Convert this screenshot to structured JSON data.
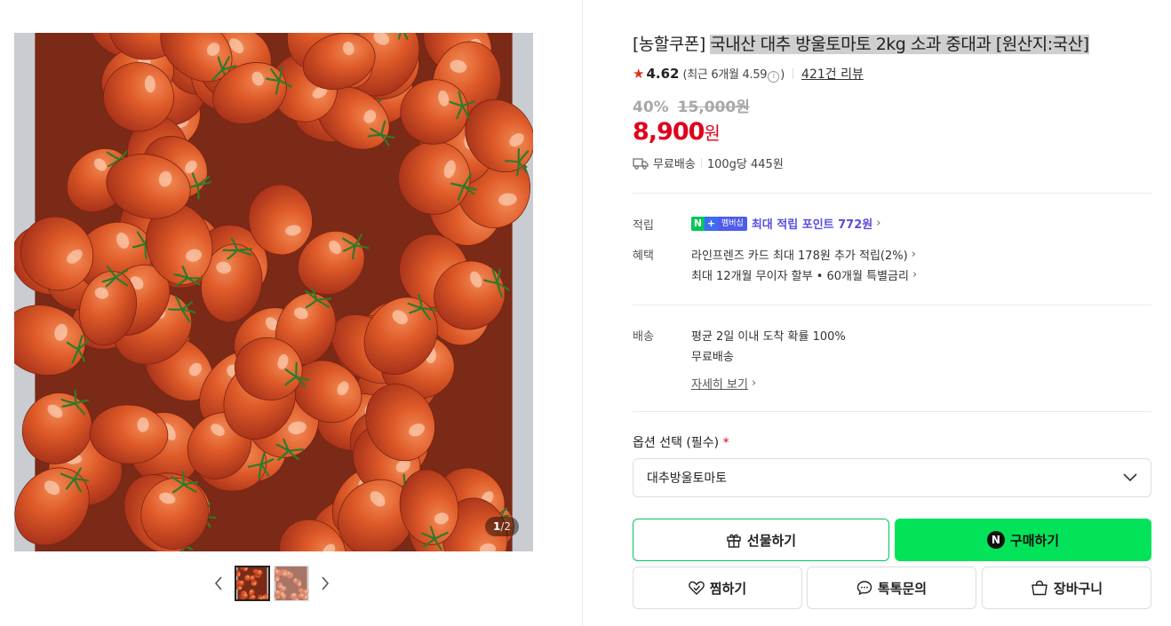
{
  "gallery": {
    "counter_current": "1",
    "counter_total": "/2"
  },
  "product": {
    "title_prefix": "[농할쿠폰]",
    "title_main": "국내산 대추 방울토마토 2kg 소과 중대과 [원산지:국산]",
    "rating": "4.62",
    "recent_rating": "(최근 6개월 4.59",
    "recent_info_icon": "ⓘ",
    "recent_close": ")",
    "reviews": "421건 리뷰",
    "discount_rate": "40%",
    "original_price": "15,000원",
    "sale_price": "8,900",
    "sale_unit": "원",
    "shipping": "무료배송",
    "unit_price": "100g당 445원"
  },
  "benefits": {
    "points_label": "적립",
    "points_badge_n": "N",
    "points_badge_plus": "+",
    "points_badge_text": "멤버십",
    "points_text": "최대 적립 포인트 772원",
    "benefit_label": "혜택",
    "card_benefit": "라인프렌즈 카드 최대 178원 추가 적립(2%)",
    "installment": "최대 12개월 무이자 할부 • 60개월 특별금리",
    "delivery_label": "배송",
    "delivery_info": "평균 2일 이내 도착 확률 100%",
    "delivery_fee": "무료배송",
    "delivery_detail": "자세히 보기"
  },
  "option": {
    "label": "옵션 선택 (필수)",
    "required_mark": "*",
    "selected": "대추방울토마토"
  },
  "buttons": {
    "gift": "선물하기",
    "buy": "구매하기",
    "buy_badge": "N",
    "wish": "찜하기",
    "talk": "톡톡문의",
    "cart": "장바구니"
  },
  "colors": {
    "price_red": "#e0001b",
    "naver_green": "#03c75a",
    "buy_green": "#03e35a",
    "point_purple": "#5a4ce0",
    "star_red": "#e0301e"
  },
  "icons": [
    "tomato-photo",
    "chevron-left-icon",
    "chevron-right-icon",
    "star-icon",
    "info-icon",
    "truck-icon",
    "chevron-down-icon",
    "gift-icon",
    "heart-icon",
    "chat-icon",
    "cart-icon"
  ]
}
